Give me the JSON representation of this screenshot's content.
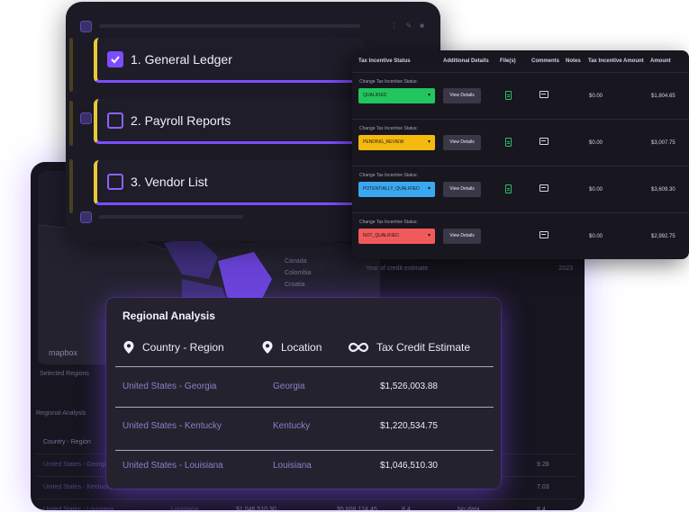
{
  "checklist": {
    "items": [
      {
        "label": "1. General Ledger",
        "checked": true
      },
      {
        "label": "2. Payroll Reports",
        "checked": false
      },
      {
        "label": "3. Vendor List",
        "checked": false
      }
    ]
  },
  "tax_table": {
    "columns": [
      "Tax Incentive Status",
      "Additional Details",
      "File(s)",
      "Comments",
      "Notes",
      "Tax Incentive Amount",
      "Amount"
    ],
    "change_caption": "Change Tax Incentive Status:",
    "details_label": "View Details",
    "rows": [
      {
        "status": "QUALIFIED",
        "color": "#22c55e",
        "tax_amount": "$0.00",
        "amount": "$1,804.65",
        "has_file": true
      },
      {
        "status": "PENDING_REVIEW",
        "color": "#f5b90f",
        "tax_amount": "$0.00",
        "amount": "$3,007.75",
        "has_file": true
      },
      {
        "status": "POTENTIALLY_QUALIFIED",
        "color": "#3aa8f0",
        "tax_amount": "$0.00",
        "amount": "$3,609.30",
        "has_file": true
      },
      {
        "status": "NOT_QUALIFIED",
        "color": "#f05a5a",
        "tax_amount": "$0.00",
        "amount": "$2,992.75",
        "has_file": false
      }
    ]
  },
  "regional": {
    "title": "Regional Analysis",
    "headers": {
      "country": "Country - Region",
      "location": "Location",
      "estimate": "Tax Credit Estimate"
    },
    "rows": [
      {
        "country": "United States - Georgia",
        "location": "Georgia",
        "estimate": "$1,526,003.88"
      },
      {
        "country": "United States - Kentucky",
        "location": "Kentucky",
        "estimate": "$1,220,534.75"
      },
      {
        "country": "United States - Louisiana",
        "location": "Louisiana",
        "estimate": "$1,046,510.30"
      }
    ]
  },
  "dashboard": {
    "map_brand": "mapbox",
    "dropdown_options": [
      "Canada",
      "Colombia",
      "Croatia"
    ],
    "fields": [
      {
        "label": "Event Date",
        "value": "No event date"
      },
      {
        "label": "Year of credit estimate",
        "value": "2023"
      }
    ],
    "selected_regions_label": "Selected Regions",
    "regional_label": "Regional Analysis",
    "country_col": "Country - Region",
    "rows": [
      {
        "country": "United States - Georgia",
        "value": "9.28"
      },
      {
        "country": "United States - Kentucky",
        "value": "7.03"
      },
      {
        "country": "United States - Louisiana",
        "location": "Louisiana",
        "v1": "$1,046,510.30",
        "v2": "$5,608,124.45",
        "v3": "8.4",
        "v4": "No data",
        "v5": "8.4"
      }
    ]
  }
}
